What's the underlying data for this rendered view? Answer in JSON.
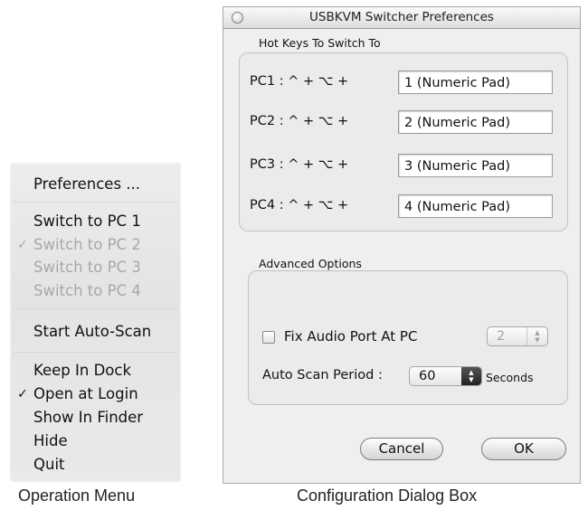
{
  "operation_menu": {
    "caption": "Operation Menu",
    "items": [
      {
        "label": "Preferences ...",
        "checked": false,
        "enabled": true
      },
      {
        "label": "Switch to PC 1",
        "checked": false,
        "enabled": true
      },
      {
        "label": "Switch to PC 2",
        "checked": true,
        "enabled": false
      },
      {
        "label": "Switch to PC 3",
        "checked": false,
        "enabled": false
      },
      {
        "label": "Switch to PC 4",
        "checked": false,
        "enabled": false
      },
      {
        "label": "Start Auto-Scan",
        "checked": false,
        "enabled": true
      },
      {
        "label": "Keep In Dock",
        "checked": false,
        "enabled": true
      },
      {
        "label": "Open at Login",
        "checked": true,
        "enabled": true
      },
      {
        "label": "Show In Finder",
        "checked": false,
        "enabled": true
      },
      {
        "label": "Hide",
        "checked": false,
        "enabled": true
      },
      {
        "label": "Quit",
        "checked": false,
        "enabled": true
      }
    ],
    "check_glyph": "✓"
  },
  "dialog": {
    "caption": "Configuration Dialog Box",
    "title": "USBKVM Switcher Preferences",
    "hotkeys": {
      "group_label": "Hot Keys To Switch To",
      "rows": [
        {
          "label": "PC1 : ^ + ⌥ +",
          "value": "1 (Numeric Pad)"
        },
        {
          "label": "PC2 : ^ + ⌥ +",
          "value": "2 (Numeric Pad)"
        },
        {
          "label": "PC3 : ^ + ⌥ +",
          "value": "3 (Numeric Pad)"
        },
        {
          "label": "PC4 : ^ + ⌥ +",
          "value": "4 (Numeric Pad)"
        }
      ]
    },
    "advanced": {
      "group_label": "Advanced Options",
      "fix_audio": {
        "label": "Fix Audio Port At PC",
        "checked": false,
        "pc_value": "2",
        "pc_enabled": false
      },
      "auto_scan": {
        "label": "Auto Scan Period :",
        "value": "60",
        "unit": "Seconds"
      }
    },
    "buttons": {
      "cancel": "Cancel",
      "ok": "OK"
    }
  }
}
